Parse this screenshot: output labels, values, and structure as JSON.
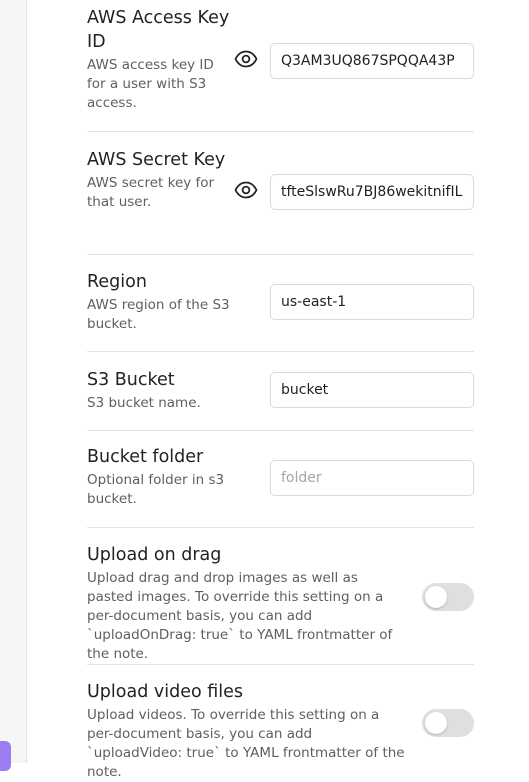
{
  "settings": {
    "access_key": {
      "name": "AWS Access Key ID",
      "desc": "AWS access key ID for a user with S3 access.",
      "value": "Q3AM3UQ867SPQQA43P"
    },
    "secret_key": {
      "name": "AWS Secret Key",
      "desc": "AWS secret key for that user.",
      "value": "tfteSlswRu7BJ86wekitnifIL"
    },
    "region": {
      "name": "Region",
      "desc": "AWS region of the S3 bucket.",
      "value": "us-east-1"
    },
    "bucket": {
      "name": "S3 Bucket",
      "desc": "S3 bucket name.",
      "value": "bucket"
    },
    "folder": {
      "name": "Bucket folder",
      "desc": "Optional folder in s3 bucket.",
      "value": "",
      "placeholder": "folder"
    },
    "upload_on_drag": {
      "name": "Upload on drag",
      "desc": "Upload drag and drop images as well as pasted images. To override this setting on a per-document basis, you can add `uploadOnDrag: true` to YAML frontmatter of the note.",
      "enabled": false
    },
    "upload_video": {
      "name": "Upload video files",
      "desc": "Upload videos. To override this setting on a per-document basis, you can add `uploadVideo: true` to YAML frontmatter of the note.",
      "enabled": false
    }
  },
  "icons": {
    "reveal": "eye-icon"
  },
  "colors": {
    "accent": "#9c7cf2",
    "toggle_off": "#dfdfdf",
    "description": "#5f5f5f",
    "divider": "#e3e3e3"
  }
}
